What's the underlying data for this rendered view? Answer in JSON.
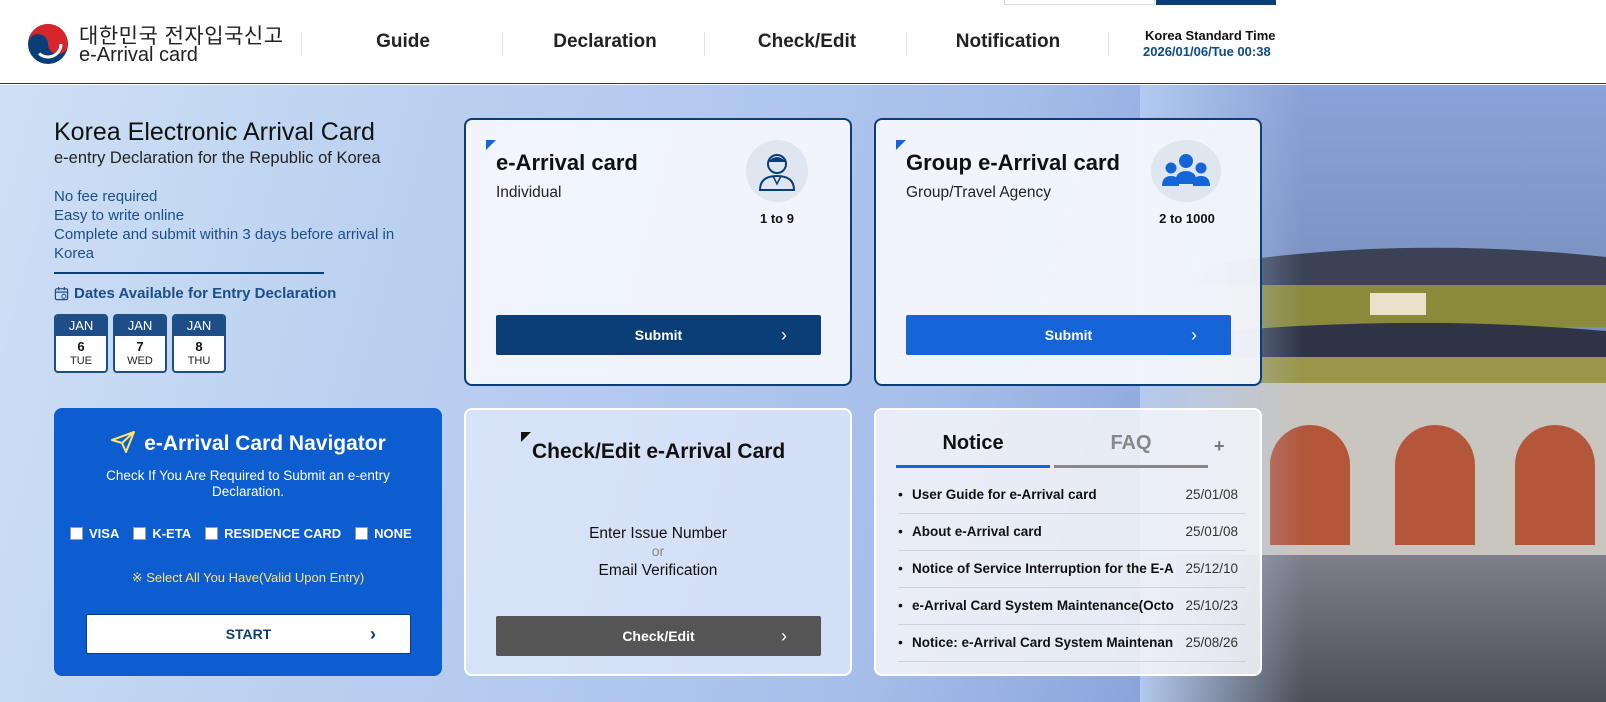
{
  "header": {
    "logo_ko": "대한민국 전자입국신고",
    "logo_en": "e-Arrival card",
    "nav": [
      "Guide",
      "Declaration",
      "Check/Edit",
      "Notification"
    ],
    "time_label": "Korea Standard Time",
    "time_value": "2026/01/06/Tue 00:38"
  },
  "intro": {
    "title": "Korea Electronic Arrival Card",
    "subtitle": "e-entry Declaration for the Republic of Korea",
    "points": [
      "No fee required",
      "Easy to write online",
      "Complete and submit within 3 days before arrival in Korea"
    ],
    "dates_heading": "Dates Available for Entry Declaration",
    "dates": [
      {
        "month": "JAN",
        "day": "6",
        "weekday": "TUE"
      },
      {
        "month": "JAN",
        "day": "7",
        "weekday": "WED"
      },
      {
        "month": "JAN",
        "day": "8",
        "weekday": "THU"
      }
    ]
  },
  "individual_card": {
    "title": "e-Arrival card",
    "subtitle": "Individual",
    "count": "1 to 9",
    "button": "Submit",
    "icon": "person-icon"
  },
  "group_card": {
    "title": "Group e-Arrival card",
    "subtitle": "Group/Travel Agency",
    "count": "2 to 1000",
    "button": "Submit",
    "icon": "group-icon"
  },
  "navigator": {
    "title": "e-Arrival Card Navigator",
    "description": "Check If You Are Required to Submit an e-entry Declaration.",
    "options": [
      "VISA",
      "K-ETA",
      "RESIDENCE CARD",
      "NONE"
    ],
    "note": "※ Select All You Have(Valid Upon Entry)",
    "button": "START"
  },
  "check_edit": {
    "title": "Check/Edit e-Arrival Card",
    "line1": "Enter Issue Number",
    "or": "or",
    "line2": "Email Verification",
    "button": "Check/Edit"
  },
  "notice": {
    "tabs": [
      "Notice",
      "FAQ"
    ],
    "more": "+",
    "items": [
      {
        "title": "User Guide for e-Arrival card",
        "date": "25/01/08"
      },
      {
        "title": "About e-Arrival card",
        "date": "25/01/08"
      },
      {
        "title": "Notice of Service Interruption for the E-A",
        "date": "25/12/10"
      },
      {
        "title": "e-Arrival Card System Maintenance(Octo",
        "date": "25/10/23"
      },
      {
        "title": "Notice: e-Arrival Card System Maintenan",
        "date": "25/08/26"
      }
    ]
  },
  "colors": {
    "navy": "#0b3e77",
    "blue": "#0b5dd0",
    "button_blue": "#1565d8",
    "gray_button": "#555555",
    "note_yellow": "#ffe36a"
  }
}
